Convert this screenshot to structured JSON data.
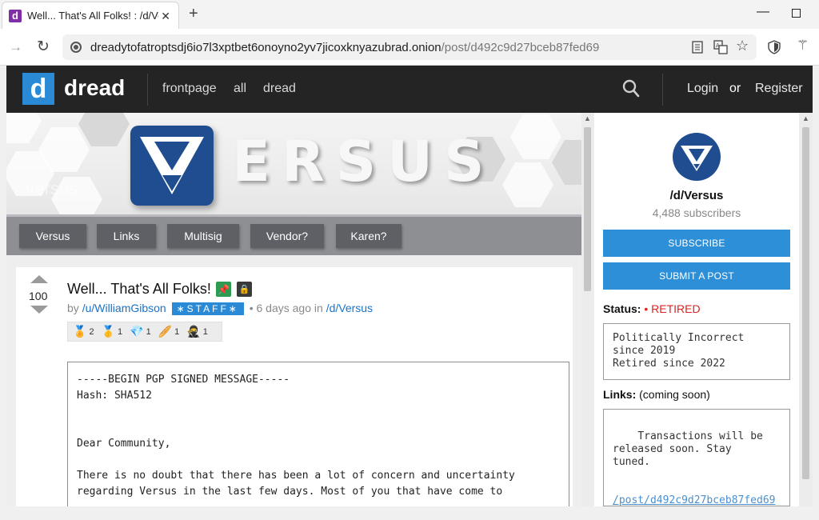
{
  "browser": {
    "tab_favicon": "d",
    "tab_title": "Well... That's All Folks! : /d/Versus",
    "tab_close": "✕",
    "new_tab": "+",
    "url_host": "dreadytofatroptsdj6io7l3xptbet6onoyno2yv7jicoxknyazubrad.onion",
    "url_path": "/post/d492c9d27bceb87fed69",
    "icons": [
      "arrow-forward-icon",
      "reload-icon",
      "onion-icon",
      "reader-view-icon",
      "translate-icon",
      "star-icon",
      "shield-icon",
      "wand-icon"
    ]
  },
  "header": {
    "logo_letter": "d",
    "logo_text": "dread",
    "nav": [
      "frontpage",
      "all",
      "dread"
    ],
    "login": "Login",
    "or": "or",
    "register": "Register"
  },
  "banner": {
    "title_letters": "ERSUS",
    "ghost_text": "Versus",
    "nav": [
      "Versus",
      "Links",
      "Multisig",
      "Vendor?",
      "Karen?"
    ]
  },
  "post": {
    "votes": "100",
    "title": "Well... That's All Folks!",
    "by": "by",
    "author": "/u/WilliamGibson",
    "badge": "∗STAFF∗",
    "time": "• 6 days ago in",
    "community": "/d/Versus",
    "awards": [
      {
        "icon": "medal-bronze-icon",
        "glyph": "🏅",
        "count": "2"
      },
      {
        "icon": "medal-gold-icon",
        "glyph": "🥇",
        "count": "1"
      },
      {
        "icon": "diamond-icon",
        "glyph": "💎",
        "count": "1"
      },
      {
        "icon": "bread-icon",
        "glyph": "🥖",
        "count": "1"
      },
      {
        "icon": "ninja-icon",
        "glyph": "🥷",
        "count": "1"
      }
    ],
    "body": "-----BEGIN PGP SIGNED MESSAGE-----\nHash: SHA512\n\n\nDear Community,\n\nThere is no doubt that there has been a lot of concern and uncertainty\nregarding Versus in the last few days. Most of you that have come to"
  },
  "sidebar": {
    "name": "/d/Versus",
    "subscribers": "4,488 subscribers",
    "subscribe": "SUBSCRIBE",
    "submit": "SUBMIT A POST",
    "status_label": "Status:",
    "status_value": "• RETIRED",
    "status_box": "Politically Incorrect\nsince 2019\nRetired since 2022",
    "links_label": "Links:",
    "links_note": "(coming soon)",
    "links_box": "Transactions will be\nreleased soon. Stay\ntuned.",
    "links_url": "/post/d492c9d27bceb87fed69"
  }
}
